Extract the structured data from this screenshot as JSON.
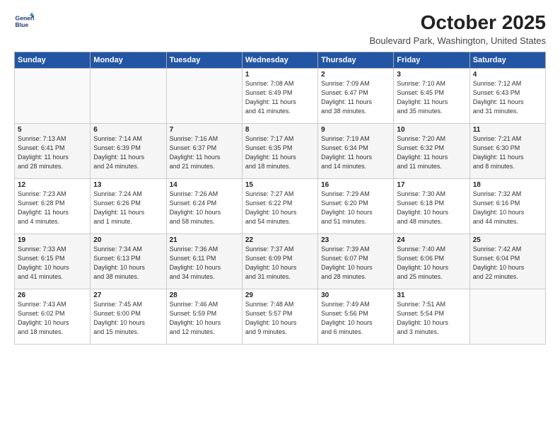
{
  "header": {
    "logo_line1": "General",
    "logo_line2": "Blue",
    "title": "October 2025",
    "location": "Boulevard Park, Washington, United States"
  },
  "days_of_week": [
    "Sunday",
    "Monday",
    "Tuesday",
    "Wednesday",
    "Thursday",
    "Friday",
    "Saturday"
  ],
  "weeks": [
    [
      {
        "day": "",
        "info": ""
      },
      {
        "day": "",
        "info": ""
      },
      {
        "day": "",
        "info": ""
      },
      {
        "day": "1",
        "info": "Sunrise: 7:08 AM\nSunset: 6:49 PM\nDaylight: 11 hours\nand 41 minutes."
      },
      {
        "day": "2",
        "info": "Sunrise: 7:09 AM\nSunset: 6:47 PM\nDaylight: 11 hours\nand 38 minutes."
      },
      {
        "day": "3",
        "info": "Sunrise: 7:10 AM\nSunset: 6:45 PM\nDaylight: 11 hours\nand 35 minutes."
      },
      {
        "day": "4",
        "info": "Sunrise: 7:12 AM\nSunset: 6:43 PM\nDaylight: 11 hours\nand 31 minutes."
      }
    ],
    [
      {
        "day": "5",
        "info": "Sunrise: 7:13 AM\nSunset: 6:41 PM\nDaylight: 11 hours\nand 28 minutes."
      },
      {
        "day": "6",
        "info": "Sunrise: 7:14 AM\nSunset: 6:39 PM\nDaylight: 11 hours\nand 24 minutes."
      },
      {
        "day": "7",
        "info": "Sunrise: 7:16 AM\nSunset: 6:37 PM\nDaylight: 11 hours\nand 21 minutes."
      },
      {
        "day": "8",
        "info": "Sunrise: 7:17 AM\nSunset: 6:35 PM\nDaylight: 11 hours\nand 18 minutes."
      },
      {
        "day": "9",
        "info": "Sunrise: 7:19 AM\nSunset: 6:34 PM\nDaylight: 11 hours\nand 14 minutes."
      },
      {
        "day": "10",
        "info": "Sunrise: 7:20 AM\nSunset: 6:32 PM\nDaylight: 11 hours\nand 11 minutes."
      },
      {
        "day": "11",
        "info": "Sunrise: 7:21 AM\nSunset: 6:30 PM\nDaylight: 11 hours\nand 8 minutes."
      }
    ],
    [
      {
        "day": "12",
        "info": "Sunrise: 7:23 AM\nSunset: 6:28 PM\nDaylight: 11 hours\nand 4 minutes."
      },
      {
        "day": "13",
        "info": "Sunrise: 7:24 AM\nSunset: 6:26 PM\nDaylight: 11 hours\nand 1 minute."
      },
      {
        "day": "14",
        "info": "Sunrise: 7:26 AM\nSunset: 6:24 PM\nDaylight: 10 hours\nand 58 minutes."
      },
      {
        "day": "15",
        "info": "Sunrise: 7:27 AM\nSunset: 6:22 PM\nDaylight: 10 hours\nand 54 minutes."
      },
      {
        "day": "16",
        "info": "Sunrise: 7:29 AM\nSunset: 6:20 PM\nDaylight: 10 hours\nand 51 minutes."
      },
      {
        "day": "17",
        "info": "Sunrise: 7:30 AM\nSunset: 6:18 PM\nDaylight: 10 hours\nand 48 minutes."
      },
      {
        "day": "18",
        "info": "Sunrise: 7:32 AM\nSunset: 6:16 PM\nDaylight: 10 hours\nand 44 minutes."
      }
    ],
    [
      {
        "day": "19",
        "info": "Sunrise: 7:33 AM\nSunset: 6:15 PM\nDaylight: 10 hours\nand 41 minutes."
      },
      {
        "day": "20",
        "info": "Sunrise: 7:34 AM\nSunset: 6:13 PM\nDaylight: 10 hours\nand 38 minutes."
      },
      {
        "day": "21",
        "info": "Sunrise: 7:36 AM\nSunset: 6:11 PM\nDaylight: 10 hours\nand 34 minutes."
      },
      {
        "day": "22",
        "info": "Sunrise: 7:37 AM\nSunset: 6:09 PM\nDaylight: 10 hours\nand 31 minutes."
      },
      {
        "day": "23",
        "info": "Sunrise: 7:39 AM\nSunset: 6:07 PM\nDaylight: 10 hours\nand 28 minutes."
      },
      {
        "day": "24",
        "info": "Sunrise: 7:40 AM\nSunset: 6:06 PM\nDaylight: 10 hours\nand 25 minutes."
      },
      {
        "day": "25",
        "info": "Sunrise: 7:42 AM\nSunset: 6:04 PM\nDaylight: 10 hours\nand 22 minutes."
      }
    ],
    [
      {
        "day": "26",
        "info": "Sunrise: 7:43 AM\nSunset: 6:02 PM\nDaylight: 10 hours\nand 18 minutes."
      },
      {
        "day": "27",
        "info": "Sunrise: 7:45 AM\nSunset: 6:00 PM\nDaylight: 10 hours\nand 15 minutes."
      },
      {
        "day": "28",
        "info": "Sunrise: 7:46 AM\nSunset: 5:59 PM\nDaylight: 10 hours\nand 12 minutes."
      },
      {
        "day": "29",
        "info": "Sunrise: 7:48 AM\nSunset: 5:57 PM\nDaylight: 10 hours\nand 9 minutes."
      },
      {
        "day": "30",
        "info": "Sunrise: 7:49 AM\nSunset: 5:56 PM\nDaylight: 10 hours\nand 6 minutes."
      },
      {
        "day": "31",
        "info": "Sunrise: 7:51 AM\nSunset: 5:54 PM\nDaylight: 10 hours\nand 3 minutes."
      },
      {
        "day": "",
        "info": ""
      }
    ]
  ]
}
